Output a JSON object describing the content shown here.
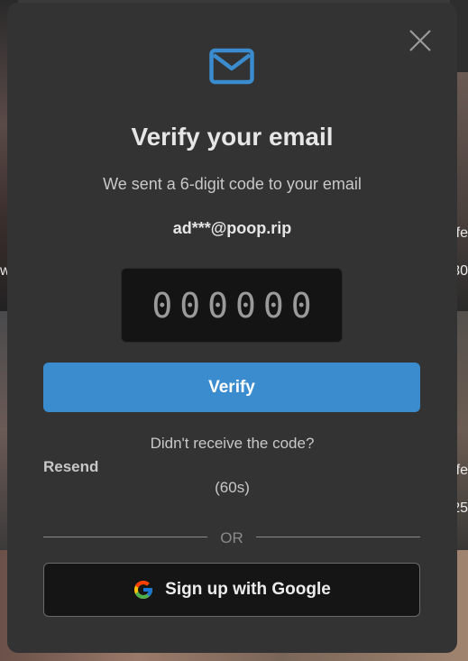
{
  "modal": {
    "close_icon": "close-icon",
    "header_icon": "mail-icon",
    "accent_color": "#3a8ccf",
    "title": "Verify your email",
    "subtitle": "We sent a 6-digit code to your email",
    "email": "ad***@poop.rip",
    "code_input": {
      "placeholder": "000000",
      "value": ""
    },
    "verify_label": "Verify",
    "didnt_receive": "Didn't receive the code?",
    "resend_label": "Resend",
    "timer": "(60s)",
    "or_label": "OR",
    "google_label": "Sign up with Google",
    "google_icon": "google-icon"
  },
  "background": {
    "peek_right_1": "fe",
    "peek_right_2": "30",
    "peek_right_3": "fe",
    "peek_right_4": "25",
    "peek_left_1": "w"
  }
}
